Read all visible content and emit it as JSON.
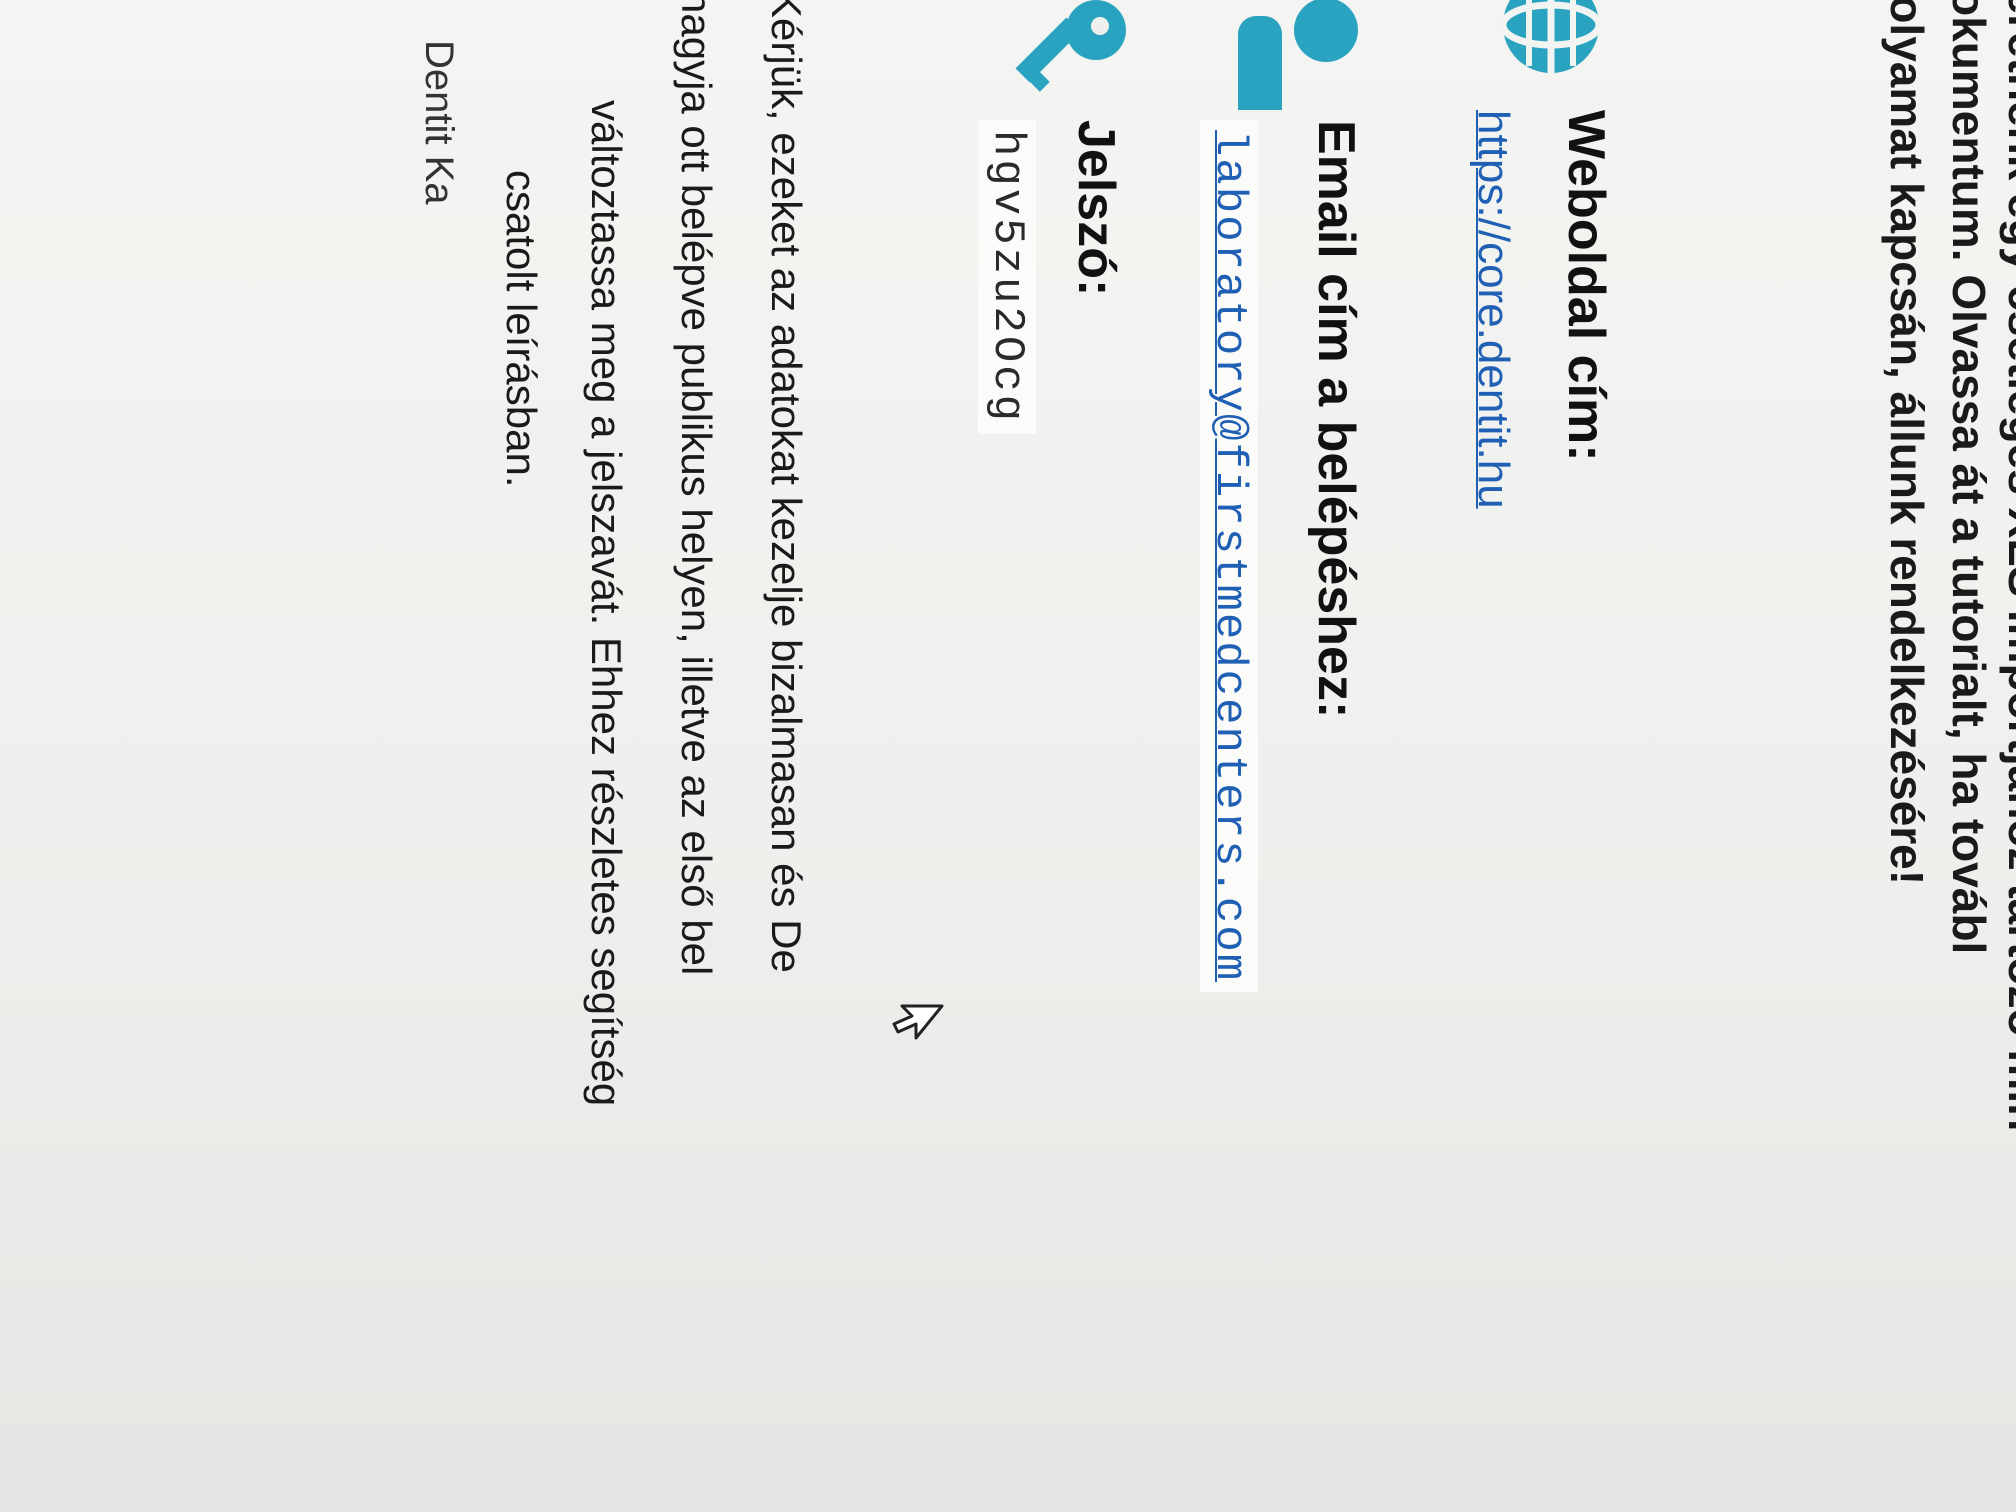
{
  "intro_lines": [
    "szeretnénk egy csetleges XLS importjánoz tartozó min",
    "dokumentum. Olvassa át a tutorialt, ha továbl",
    "folyamat kapcsán, állunk rendelkezésére!"
  ],
  "website": {
    "icon": "globe-icon",
    "label": "Weboldal cím:",
    "url": "https://core.dentit.hu"
  },
  "email": {
    "icon": "user-icon",
    "label": "Email cím a belépéshez:",
    "value": "laboratory@firstmedcenters.com"
  },
  "password": {
    "icon": "key-icon",
    "label": "Jelszó:",
    "value": "hgv5zu2Ocg"
  },
  "notice_lines": [
    "Kérjük, ezeket az adatokat kezelje bizalmasan és De",
    "hagyja ott belépve publikus helyen, illetve az első bel",
    "változtassa meg a jelszavát. Ehhez részletes segítség",
    "csatolt leírásban."
  ],
  "side_note": "Dentit Ka",
  "colors": {
    "accent": "#2aa3c0",
    "link": "#1f5fb4"
  }
}
